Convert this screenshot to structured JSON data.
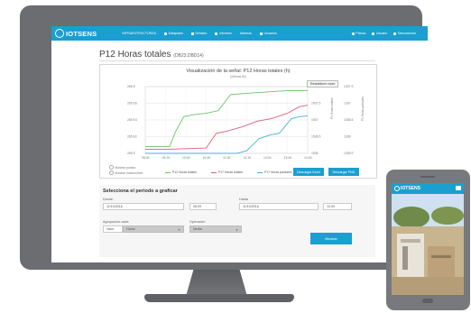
{
  "app": {
    "logo": "IOTSENS",
    "nav": [
      "INFRAESTRUCTURAS",
      "Dataplans",
      "Señales",
      "Informes",
      "Alarmas",
      "Usuarios"
    ],
    "nav_right": [
      "Planos",
      "Usuario",
      "Desconectar"
    ]
  },
  "page": {
    "title": "P12 Horas totales",
    "code": "(DB23.DBD14)"
  },
  "chart": {
    "title": "Visualización de la señal: P12 Horas totales (h)",
    "subtitle": "(Ultimas 6h)",
    "reset_label": "Restablecer zoom",
    "left_ticks": [
      "266 E",
      "265 E6",
      "265 E4",
      "265 E2",
      "265 E"
    ],
    "right_ticks_a": [
      "1938",
      "1937.5",
      "1937",
      "1936.5",
      "1936"
    ],
    "right_ticks_b": [
      "1337 E",
      "1337",
      "1336.5",
      "1336",
      "1335 E"
    ],
    "right_axis_a_label": "P1 Horas totales",
    "right_axis_b_label": "P1 Horas parciales",
    "x_ticks": [
      "08:30",
      "09:15",
      "10:00",
      "10:45",
      "11:30",
      "12:15",
      "13:00",
      "13:45",
      "14:30"
    ],
    "show_points": "Mostrar puntos",
    "show_max_min": "Mostrar máximo/mín",
    "legend": [
      {
        "name": "P12 Horas totales",
        "color": "#6cc26a"
      },
      {
        "name": "P17 Horas totales",
        "color": "#d8607a"
      },
      {
        "name": "P17 Horas parciales",
        "color": "#3fb3dc"
      }
    ],
    "download_excel": "Descargar Excel",
    "download_pdf": "Descargar PNG"
  },
  "chart_data": {
    "type": "line",
    "x": [
      "08:30",
      "09:15",
      "10:00",
      "10:45",
      "11:30",
      "12:15",
      "13:00",
      "13:45",
      "14:30"
    ],
    "series": [
      {
        "name": "P12 Horas totales",
        "color": "#6cc26a",
        "points": [
          [
            0,
            0.1
          ],
          [
            0.6,
            0.1
          ],
          [
            1.2,
            0.1
          ],
          [
            1.5,
            0.33
          ],
          [
            1.9,
            0.55
          ],
          [
            2.4,
            0.58
          ],
          [
            3,
            0.6
          ],
          [
            3.6,
            0.64
          ],
          [
            4.2,
            0.88
          ],
          [
            5,
            0.9
          ],
          [
            6,
            0.92
          ],
          [
            7,
            0.94
          ],
          [
            8,
            0.94
          ]
        ]
      },
      {
        "name": "P17 Horas totales",
        "color": "#d8607a",
        "points": [
          [
            0,
            0.06
          ],
          [
            1,
            0.06
          ],
          [
            2,
            0.07
          ],
          [
            3,
            0.08
          ],
          [
            3.5,
            0.3
          ],
          [
            4,
            0.33
          ],
          [
            4.8,
            0.4
          ],
          [
            5.5,
            0.48
          ],
          [
            6.2,
            0.52
          ],
          [
            7,
            0.6
          ],
          [
            7.6,
            0.7
          ],
          [
            8,
            0.72
          ]
        ]
      },
      {
        "name": "P17 Horas parciales",
        "color": "#3fb3dc",
        "points": [
          [
            0,
            0.0
          ],
          [
            3,
            0.0
          ],
          [
            4.5,
            0.0
          ],
          [
            5,
            0.04
          ],
          [
            5.6,
            0.22
          ],
          [
            6.2,
            0.28
          ],
          [
            6.6,
            0.3
          ],
          [
            7.2,
            0.52
          ],
          [
            7.6,
            0.55
          ],
          [
            8,
            0.56
          ]
        ]
      }
    ]
  },
  "period": {
    "title": "Selecciona el periodo a graficar",
    "desde_label": "Desde",
    "desde_date": "11/10/2016",
    "desde_time": "06:09",
    "hasta_label": "Hasta",
    "hasta_date": "11/10/2016",
    "hasta_time": "12:00",
    "agrupacion_label": "Agrupación cada",
    "agrupacion_value": "Valor",
    "agrupacion_unit": "Horas",
    "operacion_label": "Operación",
    "operacion_value": "Media",
    "mostrar": "Mostrar"
  },
  "phone": {
    "logo": "IOTSENS"
  }
}
